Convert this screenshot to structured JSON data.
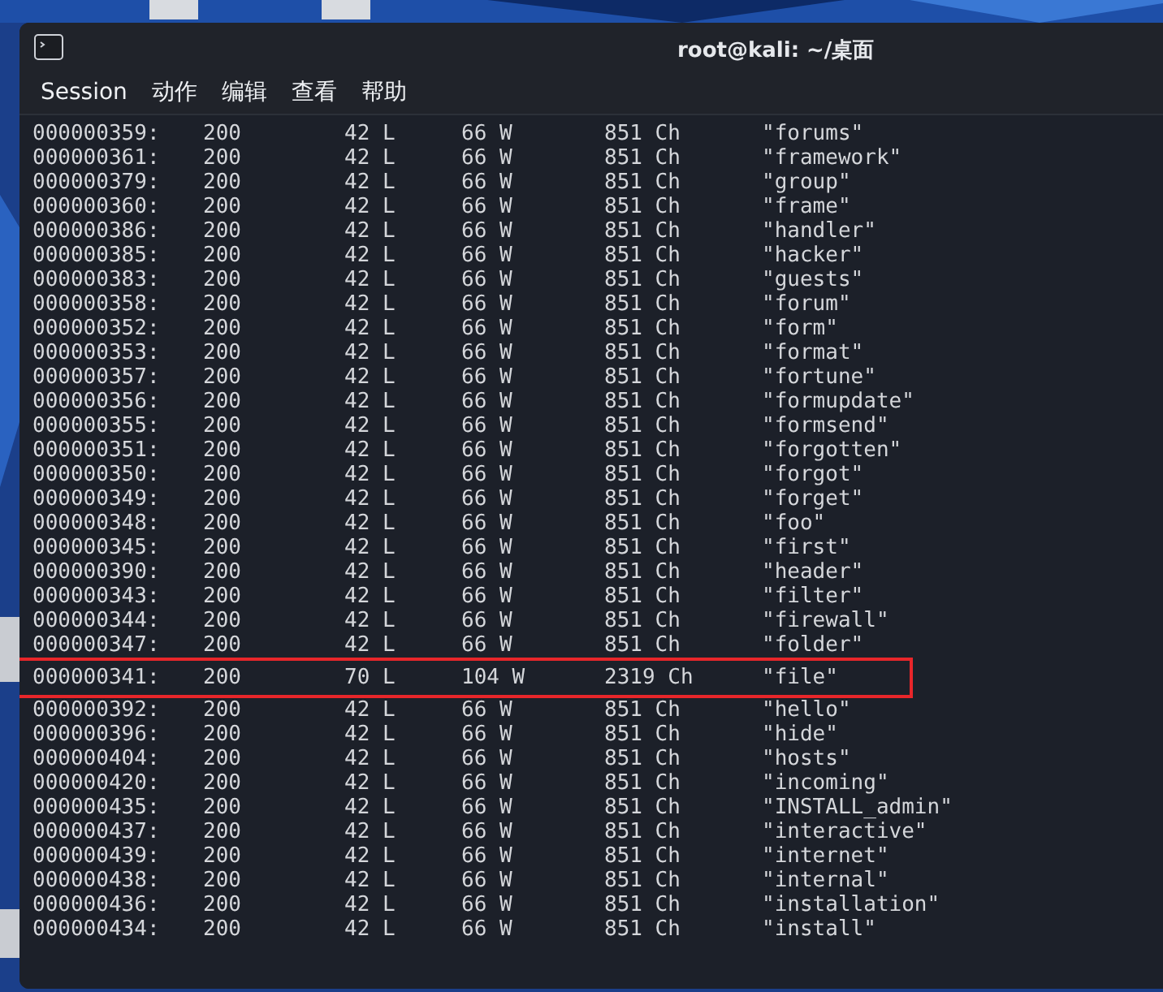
{
  "window": {
    "title": "root@kali: ~/桌面"
  },
  "menu": [
    "Session",
    "动作",
    "编辑",
    "查看",
    "帮助"
  ],
  "rows": [
    {
      "id": "000000359:",
      "code": "200",
      "lines": "42 L",
      "words": "66 W",
      "chars": "851 Ch",
      "payload": "\"forums\"",
      "highlighted": false
    },
    {
      "id": "000000361:",
      "code": "200",
      "lines": "42 L",
      "words": "66 W",
      "chars": "851 Ch",
      "payload": "\"framework\"",
      "highlighted": false
    },
    {
      "id": "000000379:",
      "code": "200",
      "lines": "42 L",
      "words": "66 W",
      "chars": "851 Ch",
      "payload": "\"group\"",
      "highlighted": false
    },
    {
      "id": "000000360:",
      "code": "200",
      "lines": "42 L",
      "words": "66 W",
      "chars": "851 Ch",
      "payload": "\"frame\"",
      "highlighted": false
    },
    {
      "id": "000000386:",
      "code": "200",
      "lines": "42 L",
      "words": "66 W",
      "chars": "851 Ch",
      "payload": "\"handler\"",
      "highlighted": false
    },
    {
      "id": "000000385:",
      "code": "200",
      "lines": "42 L",
      "words": "66 W",
      "chars": "851 Ch",
      "payload": "\"hacker\"",
      "highlighted": false
    },
    {
      "id": "000000383:",
      "code": "200",
      "lines": "42 L",
      "words": "66 W",
      "chars": "851 Ch",
      "payload": "\"guests\"",
      "highlighted": false
    },
    {
      "id": "000000358:",
      "code": "200",
      "lines": "42 L",
      "words": "66 W",
      "chars": "851 Ch",
      "payload": "\"forum\"",
      "highlighted": false
    },
    {
      "id": "000000352:",
      "code": "200",
      "lines": "42 L",
      "words": "66 W",
      "chars": "851 Ch",
      "payload": "\"form\"",
      "highlighted": false
    },
    {
      "id": "000000353:",
      "code": "200",
      "lines": "42 L",
      "words": "66 W",
      "chars": "851 Ch",
      "payload": "\"format\"",
      "highlighted": false
    },
    {
      "id": "000000357:",
      "code": "200",
      "lines": "42 L",
      "words": "66 W",
      "chars": "851 Ch",
      "payload": "\"fortune\"",
      "highlighted": false
    },
    {
      "id": "000000356:",
      "code": "200",
      "lines": "42 L",
      "words": "66 W",
      "chars": "851 Ch",
      "payload": "\"formupdate\"",
      "highlighted": false
    },
    {
      "id": "000000355:",
      "code": "200",
      "lines": "42 L",
      "words": "66 W",
      "chars": "851 Ch",
      "payload": "\"formsend\"",
      "highlighted": false
    },
    {
      "id": "000000351:",
      "code": "200",
      "lines": "42 L",
      "words": "66 W",
      "chars": "851 Ch",
      "payload": "\"forgotten\"",
      "highlighted": false
    },
    {
      "id": "000000350:",
      "code": "200",
      "lines": "42 L",
      "words": "66 W",
      "chars": "851 Ch",
      "payload": "\"forgot\"",
      "highlighted": false
    },
    {
      "id": "000000349:",
      "code": "200",
      "lines": "42 L",
      "words": "66 W",
      "chars": "851 Ch",
      "payload": "\"forget\"",
      "highlighted": false
    },
    {
      "id": "000000348:",
      "code": "200",
      "lines": "42 L",
      "words": "66 W",
      "chars": "851 Ch",
      "payload": "\"foo\"",
      "highlighted": false
    },
    {
      "id": "000000345:",
      "code": "200",
      "lines": "42 L",
      "words": "66 W",
      "chars": "851 Ch",
      "payload": "\"first\"",
      "highlighted": false
    },
    {
      "id": "000000390:",
      "code": "200",
      "lines": "42 L",
      "words": "66 W",
      "chars": "851 Ch",
      "payload": "\"header\"",
      "highlighted": false
    },
    {
      "id": "000000343:",
      "code": "200",
      "lines": "42 L",
      "words": "66 W",
      "chars": "851 Ch",
      "payload": "\"filter\"",
      "highlighted": false
    },
    {
      "id": "000000344:",
      "code": "200",
      "lines": "42 L",
      "words": "66 W",
      "chars": "851 Ch",
      "payload": "\"firewall\"",
      "highlighted": false
    },
    {
      "id": "000000347:",
      "code": "200",
      "lines": "42 L",
      "words": "66 W",
      "chars": "851 Ch",
      "payload": "\"folder\"",
      "highlighted": false
    },
    {
      "id": "000000341:",
      "code": "200",
      "lines": "70 L",
      "words": "104 W",
      "chars": "2319 Ch",
      "payload": "\"file\"",
      "highlighted": true
    },
    {
      "id": "000000392:",
      "code": "200",
      "lines": "42 L",
      "words": "66 W",
      "chars": "851 Ch",
      "payload": "\"hello\"",
      "highlighted": false
    },
    {
      "id": "000000396:",
      "code": "200",
      "lines": "42 L",
      "words": "66 W",
      "chars": "851 Ch",
      "payload": "\"hide\"",
      "highlighted": false
    },
    {
      "id": "000000404:",
      "code": "200",
      "lines": "42 L",
      "words": "66 W",
      "chars": "851 Ch",
      "payload": "\"hosts\"",
      "highlighted": false
    },
    {
      "id": "000000420:",
      "code": "200",
      "lines": "42 L",
      "words": "66 W",
      "chars": "851 Ch",
      "payload": "\"incoming\"",
      "highlighted": false
    },
    {
      "id": "000000435:",
      "code": "200",
      "lines": "42 L",
      "words": "66 W",
      "chars": "851 Ch",
      "payload": "\"INSTALL_admin\"",
      "highlighted": false
    },
    {
      "id": "000000437:",
      "code": "200",
      "lines": "42 L",
      "words": "66 W",
      "chars": "851 Ch",
      "payload": "\"interactive\"",
      "highlighted": false
    },
    {
      "id": "000000439:",
      "code": "200",
      "lines": "42 L",
      "words": "66 W",
      "chars": "851 Ch",
      "payload": "\"internet\"",
      "highlighted": false
    },
    {
      "id": "000000438:",
      "code": "200",
      "lines": "42 L",
      "words": "66 W",
      "chars": "851 Ch",
      "payload": "\"internal\"",
      "highlighted": false
    },
    {
      "id": "000000436:",
      "code": "200",
      "lines": "42 L",
      "words": "66 W",
      "chars": "851 Ch",
      "payload": "\"installation\"",
      "highlighted": false
    },
    {
      "id": "000000434:",
      "code": "200",
      "lines": "42 L",
      "words": "66 W",
      "chars": "851 Ch",
      "payload": "\"install\"",
      "highlighted": false
    }
  ]
}
